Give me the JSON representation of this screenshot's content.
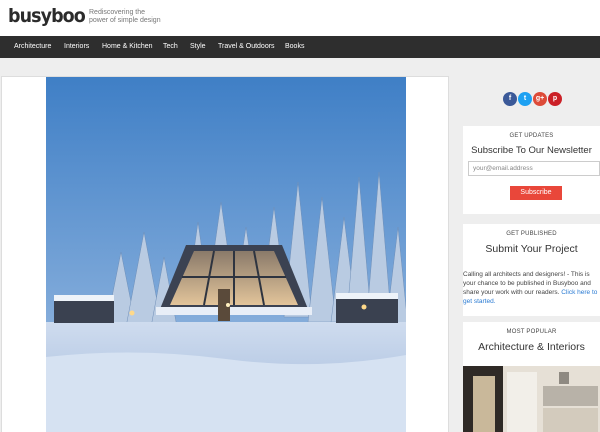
{
  "site": {
    "logo": "busyboo",
    "tagline_line1": "Rediscovering the",
    "tagline_line2": "power of simple design"
  },
  "nav": {
    "items": [
      {
        "label": "Architecture"
      },
      {
        "label": "Interiors"
      },
      {
        "label": "Home & Kitchen"
      },
      {
        "label": "Tech"
      },
      {
        "label": "Style"
      },
      {
        "label": "Travel & Outdoors"
      },
      {
        "label": "Books"
      }
    ]
  },
  "social": {
    "facebook": "f",
    "twitter": "t",
    "googleplus": "g+",
    "pinterest": "p"
  },
  "newsletter": {
    "label": "GET UPDATES",
    "title": "Subscribe To Our Newsletter",
    "email_placeholder": "your@email.address",
    "button": "Subscribe"
  },
  "submit": {
    "label": "GET PUBLISHED",
    "title": "Submit Your Project",
    "text": "Calling all architects and designers! - This is your chance to be published in Busyboo and share your work with our readers. ",
    "link": "Click here to get started."
  },
  "popular": {
    "label": "MOST POPULAR",
    "title": "Architecture & Interiors"
  },
  "colors": {
    "nav_bg": "#2e2e2e",
    "accent": "#e9473a",
    "link": "#2a7bd3",
    "facebook": "#3b5998",
    "twitter": "#1da1f2",
    "googleplus": "#dd4b39",
    "pinterest": "#cb2027"
  }
}
